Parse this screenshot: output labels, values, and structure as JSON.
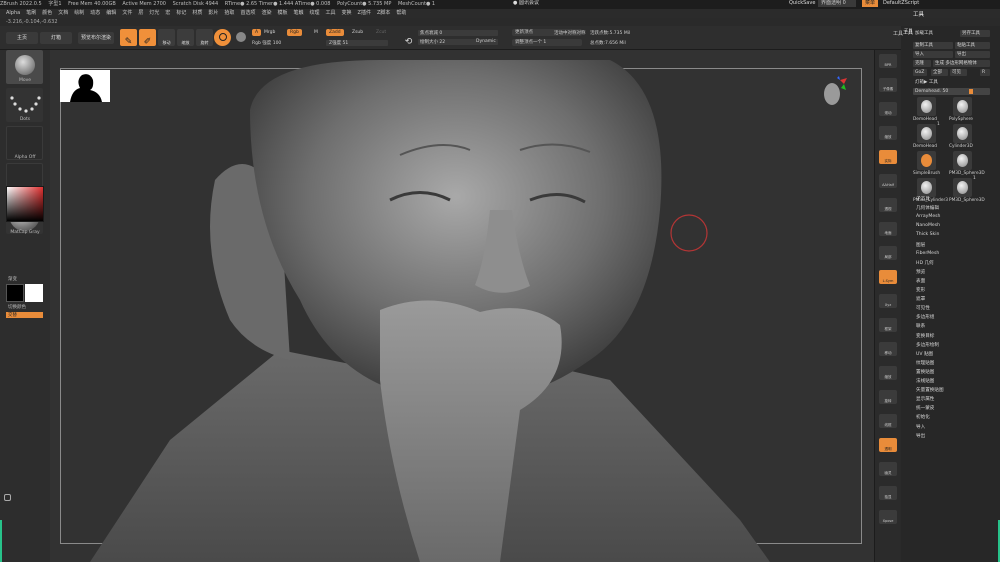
{
  "titlebar": {
    "app": "ZBrush 2022.0.5",
    "doc": "字型1",
    "stats": [
      "Free Mem 40.00GB",
      "Active Mem 2700",
      "Scratch Disk 4944",
      "RTime● 2.65 Timer● 1.444 ATime● 0.008",
      "PolyCount● 5.735 MP",
      "MeshCount● 1"
    ],
    "center": "● 圆讯会议",
    "quicksave": "QuickSave",
    "seethrough": "界面透明 0",
    "menus_label": "菜单",
    "script": "DefaultZScript"
  },
  "menubar": [
    "Alpha",
    "笔刷",
    "颜色",
    "文档",
    "绘制",
    "动态",
    "编辑",
    "文件",
    "层",
    "灯光",
    "宏",
    "标记",
    "材质",
    "影片",
    "拾取",
    "首选项",
    "渲染",
    "模板",
    "笔触",
    "纹理",
    "工具",
    "变换",
    "Z插件",
    "Z脚本",
    "帮助"
  ],
  "coords": "-3.216,-0.104,-0.632",
  "shelf": {
    "home": "主页",
    "lightbox": "灯箱",
    "preview": "预览布尔渲染",
    "edit": "编辑",
    "draw": "绘制",
    "move": "移动",
    "scale": "缩放",
    "rotate": "旋转",
    "a_label": "A",
    "mrgb": "Mrgb",
    "rgb": "Rgb",
    "m": "M",
    "rgb_intensity": "Rgb 强度 100",
    "zadd": "Zadd",
    "zsub": "Zsub",
    "zcut": "Zcut",
    "z_intensity": "Z强度 51",
    "focal_shift": "焦点衰减 0",
    "draw_size": "绘制大小 22",
    "dynamic": "Dynamic",
    "relative_persp": "透视图",
    "activepoints": "活跃点数:5.735 Mil",
    "totalpoints": "总点数:7.656 Mil",
    "sym_flip": "更新顶点",
    "sym2": "活动中对称对称",
    "sym3": "调整顶点一个 1"
  },
  "leftshelf": {
    "brush": "Move",
    "stroke": "Dots",
    "alpha": "Alpha Off",
    "texture": "Texture Off",
    "material": "MatCap Gray",
    "gradient": "渐变",
    "switch": "切换颜色",
    "alternate": "交替"
  },
  "panel": {
    "title": "工具",
    "subtitle": "工具",
    "loadtool": "加载工具",
    "savetool": "另存工具",
    "copytool": "复制工具",
    "pastetool": "粘贴工具",
    "import": "导入",
    "export": "导出",
    "clone": "克隆",
    "makepoly": "生成 多边形网格物体",
    "goz": "GoZ",
    "all": "全部",
    "visible": "可见",
    "r": "R",
    "lightbox_tools": "灯箱▶ 工具",
    "current": "Demohead. 50",
    "tools": [
      "DemoHead",
      "PolySphere",
      "DemoHead",
      "Cylinder3D",
      "SimpleBrush",
      "PM3D_Sphere3D",
      "PM3D_Cylinder3",
      "PM3D_Sphere3D"
    ],
    "tool_counts": [
      "",
      "",
      "1",
      "",
      "",
      "",
      "",
      "1"
    ],
    "sections": [
      "子工具",
      "几何体编辑",
      "ArrayMesh",
      "NanoMesh",
      "Thick Skin",
      "图层",
      "FiberMesh",
      "HD 几何",
      "预览",
      "表面",
      "变形",
      "遮罩",
      "可见性",
      "多边形组",
      "联系",
      "变换目标",
      "多边形绘制",
      "UV 贴图",
      "纹理贴图",
      "置换贴图",
      "法线贴图",
      "矢量置换贴图",
      "显示属性",
      "统一蒙皮",
      "初始化",
      "导入",
      "导出"
    ]
  },
  "dock": [
    "BPR",
    "子像素",
    "滚动",
    "缩放",
    "实际",
    "AAHalf",
    "透视",
    "地面",
    "局部",
    "L.Sym",
    "Xyz",
    "框架",
    "移动",
    "缩放",
    "旋转",
    "线框",
    "透明",
    "幽灵",
    "独显",
    "Xpose"
  ],
  "colors": {
    "accent": "#e98c3a",
    "bg": "#2a2a2a",
    "canvas": "#323232",
    "brush_ring": "#b33535"
  }
}
